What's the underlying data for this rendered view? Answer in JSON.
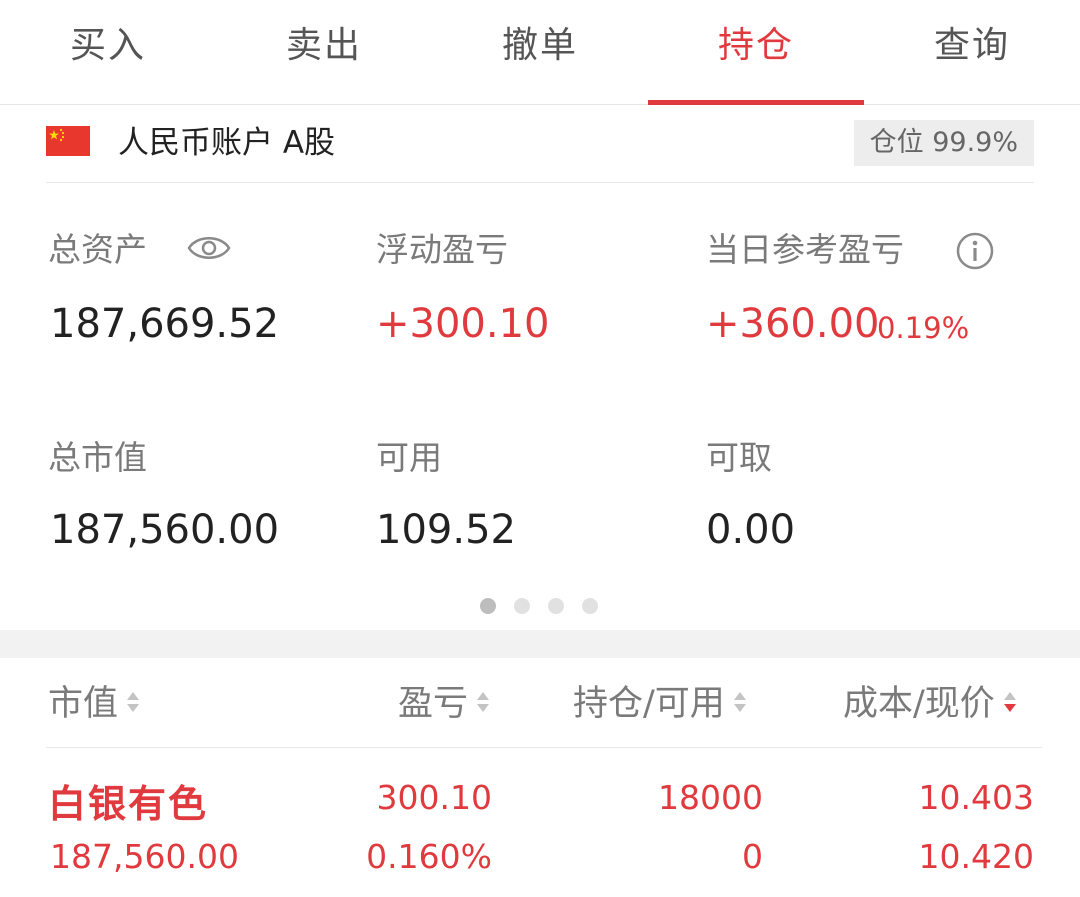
{
  "tabs": [
    {
      "label": "买入",
      "active": false
    },
    {
      "label": "卖出",
      "active": false
    },
    {
      "label": "撤单",
      "active": false
    },
    {
      "label": "持仓",
      "active": true
    },
    {
      "label": "查询",
      "active": false
    }
  ],
  "account": {
    "name": "人民币账户 A股",
    "flag_icon": "china-flag-icon",
    "position_label": "仓位 99.9%"
  },
  "summary": {
    "total_assets_label": "总资产",
    "total_assets_value": "187,669.52",
    "floating_pl_label": "浮动盈亏",
    "floating_pl_value": "+300.10",
    "daily_pl_label": "当日参考盈亏",
    "daily_pl_value": "+360.00",
    "daily_pl_pct": "0.19%",
    "market_value_label": "总市值",
    "market_value_value": "187,560.00",
    "available_label": "可用",
    "available_value": "109.52",
    "withdrawable_label": "可取",
    "withdrawable_value": "0.00"
  },
  "pager": {
    "count": 4,
    "active_index": 0
  },
  "holdings_header": {
    "col1": "市值",
    "col2": "盈亏",
    "col3": "持仓/可用",
    "col4": "成本/现价"
  },
  "holdings": [
    {
      "name": "白银有色",
      "market_value": "187,560.00",
      "pl": "300.10",
      "pl_pct": "0.160%",
      "position": "18000",
      "available": "0",
      "cost": "10.403",
      "price": "10.420"
    }
  ],
  "colors": {
    "accent_red": "#e03a3e",
    "label_gray": "#7a7a7a",
    "text_dark": "#222222"
  }
}
